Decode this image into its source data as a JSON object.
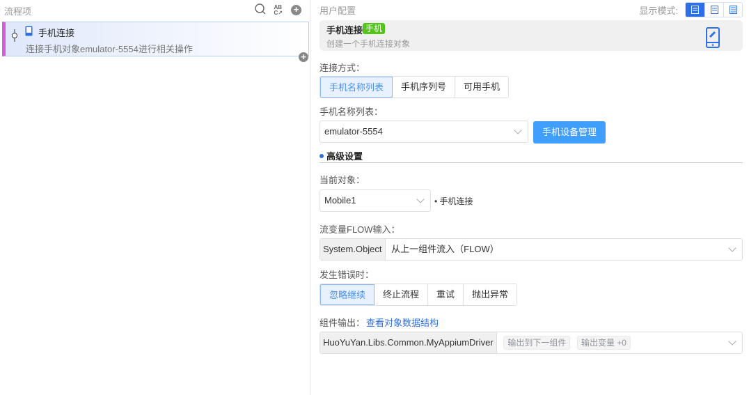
{
  "left": {
    "title": "流程项",
    "item": {
      "title": "手机连接",
      "desc": "连接手机对象emulator-5554进行相关操作"
    }
  },
  "right": {
    "title": "用户配置",
    "display_mode_label": "显示模式:",
    "header": {
      "title": "手机连接",
      "badge": "手机",
      "desc": "创建一个手机连接对象"
    },
    "conn_label": "连接方式：",
    "conn_options": [
      "手机名称列表",
      "手机序列号",
      "可用手机"
    ],
    "name_list_label": "手机名称列表：",
    "name_value": "emulator-5554",
    "manage_button": "手机设备管理",
    "advanced": "高级设置",
    "current_obj_label": "当前对象：",
    "current_obj": "Mobile1",
    "current_obj_note": "手机连接",
    "flow_label": "流变量FLOW输入：",
    "flow_type": "System.Object",
    "flow_value": "从上一组件流入（FLOW）",
    "error_label": "发生错误时：",
    "error_options": [
      "忽略继续",
      "终止流程",
      "重试",
      "抛出异常"
    ],
    "output_label": "组件输出：",
    "output_link": "查看对象数据结构",
    "output_type": "HuoYuYan.Libs.Common.MyAppiumDriver",
    "output_tags": [
      "输出到下一组件",
      "输出变量 +0"
    ]
  },
  "colors": {
    "accent": "#409eff",
    "badge": "#52c41a",
    "card_stripe": "#d35ddb"
  }
}
